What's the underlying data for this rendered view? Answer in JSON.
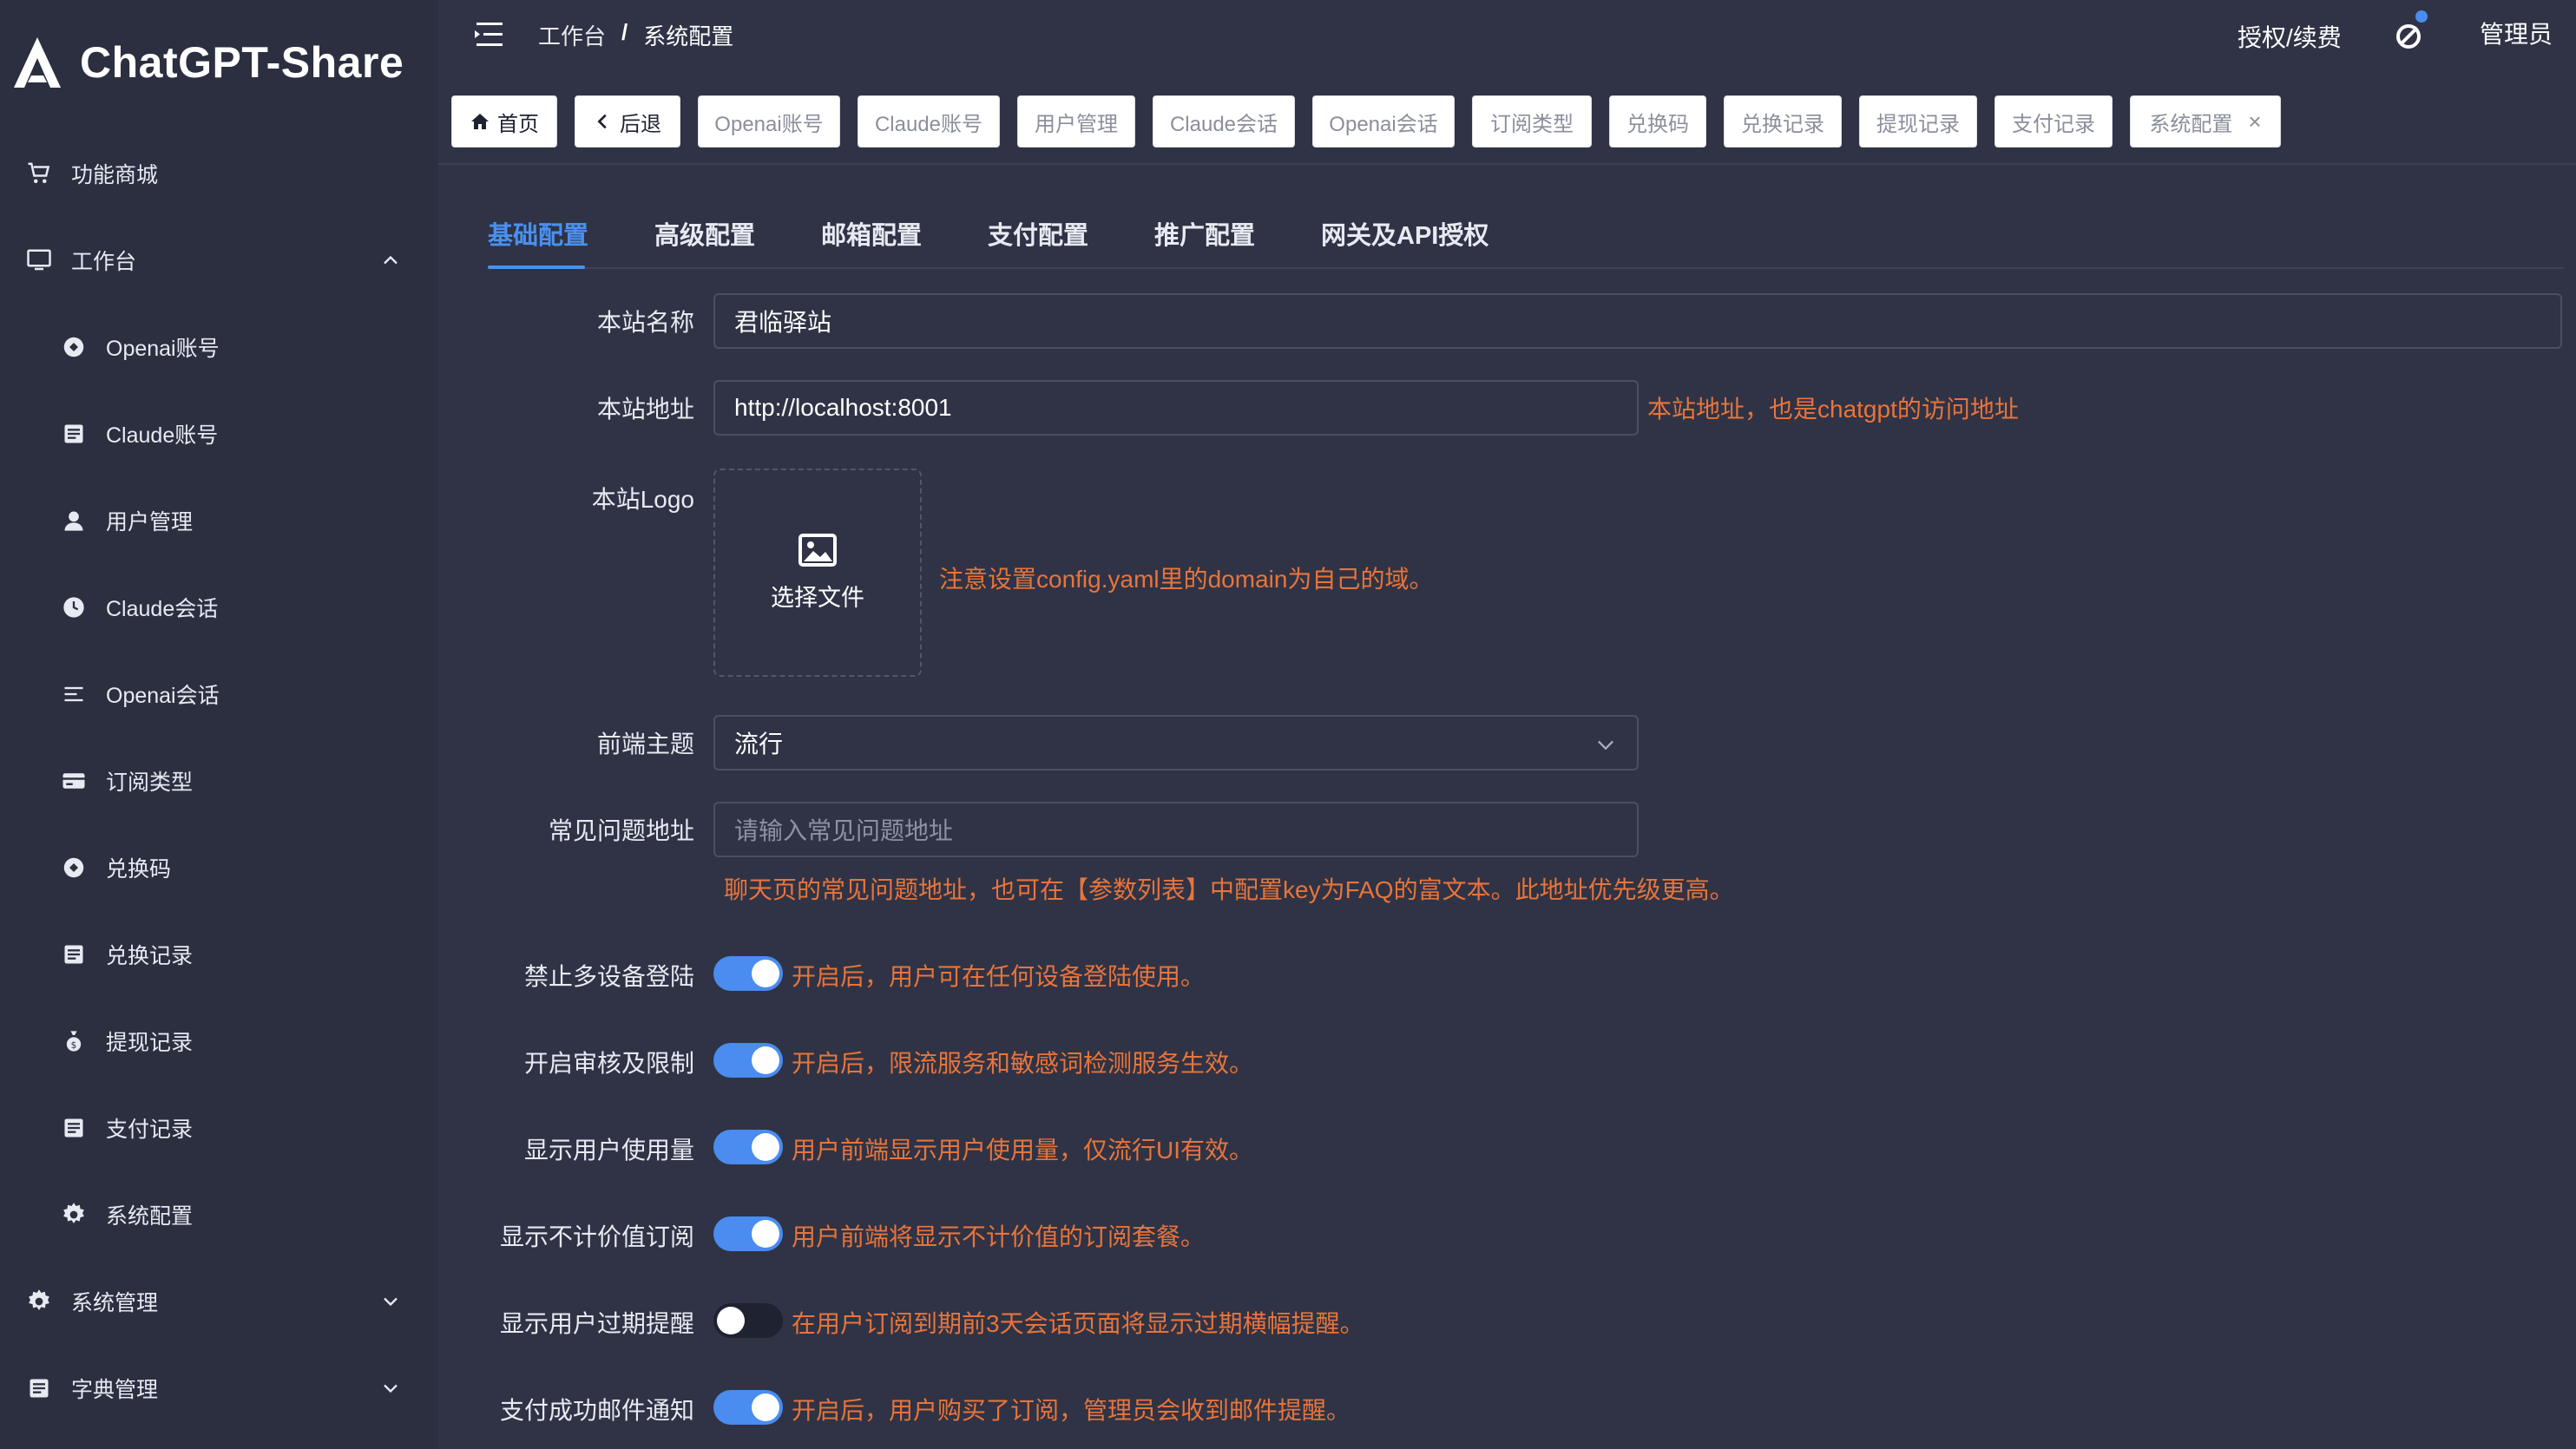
{
  "app": {
    "brand": "ChatGPT-Share"
  },
  "sidebar": {
    "items": [
      {
        "label": "功能商城",
        "icon": "cart-icon"
      },
      {
        "label": "工作台",
        "icon": "monitor-icon"
      },
      {
        "label": "Openai账号",
        "icon": "openai-icon"
      },
      {
        "label": "Claude账号",
        "icon": "list-icon"
      },
      {
        "label": "用户管理",
        "icon": "user-icon"
      },
      {
        "label": "Claude会话",
        "icon": "clock-icon"
      },
      {
        "label": "Openai会话",
        "icon": "menu-lines-icon"
      },
      {
        "label": "订阅类型",
        "icon": "card-icon"
      },
      {
        "label": "兑换码",
        "icon": "openai-icon"
      },
      {
        "label": "兑换记录",
        "icon": "list-icon"
      },
      {
        "label": "提现记录",
        "icon": "money-bag-icon"
      },
      {
        "label": "支付记录",
        "icon": "list-icon"
      },
      {
        "label": "系统配置",
        "icon": "gear-icon"
      },
      {
        "label": "系统管理",
        "icon": "gear-icon"
      },
      {
        "label": "字典管理",
        "icon": "list-icon"
      }
    ]
  },
  "header": {
    "breadcrumb": [
      "工作台",
      "/",
      "系统配置"
    ],
    "auth_label": "授权/续费",
    "admin_label": "管理员"
  },
  "tags": [
    {
      "label": "首页",
      "icon": "home-icon"
    },
    {
      "label": "后退",
      "icon": "chevron-left-icon"
    },
    {
      "label": "Openai账号"
    },
    {
      "label": "Claude账号"
    },
    {
      "label": "用户管理"
    },
    {
      "label": "Claude会话"
    },
    {
      "label": "Openai会话"
    },
    {
      "label": "订阅类型"
    },
    {
      "label": "兑换码"
    },
    {
      "label": "兑换记录"
    },
    {
      "label": "提现记录"
    },
    {
      "label": "支付记录"
    },
    {
      "label": "系统配置",
      "close": "×"
    }
  ],
  "tabs": [
    "基础配置",
    "高级配置",
    "邮箱配置",
    "支付配置",
    "推广配置",
    "网关及API授权"
  ],
  "form": {
    "site_name": {
      "label": "本站名称",
      "value": "君临驿站"
    },
    "site_url": {
      "label": "本站地址",
      "value": "http://localhost:8001",
      "hint": "本站地址，也是chatgpt的访问地址"
    },
    "site_logo": {
      "label": "本站Logo",
      "upload_label": "选择文件",
      "hint": "注意设置config.yaml里的domain为自己的域。"
    },
    "theme": {
      "label": "前端主题",
      "value": "流行"
    },
    "faq_url": {
      "label": "常见问题地址",
      "placeholder": "请输入常见问题地址",
      "hint": "聊天页的常见问题地址，也可在【参数列表】中配置key为FAQ的富文本。此地址优先级更高。"
    },
    "switches": [
      {
        "label": "禁止多设备登陆",
        "on": true,
        "hint": "开启后，用户可在任何设备登陆使用。"
      },
      {
        "label": "开启审核及限制",
        "on": true,
        "hint": "开启后，限流服务和敏感词检测服务生效。"
      },
      {
        "label": "显示用户使用量",
        "on": true,
        "hint": "用户前端显示用户使用量，仅流行UI有效。"
      },
      {
        "label": "显示不计价值订阅",
        "on": true,
        "hint": "用户前端将显示不计价值的订阅套餐。"
      },
      {
        "label": "显示用户过期提醒",
        "on": false,
        "hint": "在用户订阅到期前3天会话页面将显示过期横幅提醒。"
      },
      {
        "label": "支付成功邮件通知",
        "on": true,
        "hint": "开启后，用户购买了订阅，管理员会收到邮件提醒。"
      }
    ]
  },
  "colors": {
    "accent": "#4a90f0",
    "hint": "#e8743b",
    "sidebar_bg": "#2b2f40",
    "main_bg": "#2f3345"
  }
}
